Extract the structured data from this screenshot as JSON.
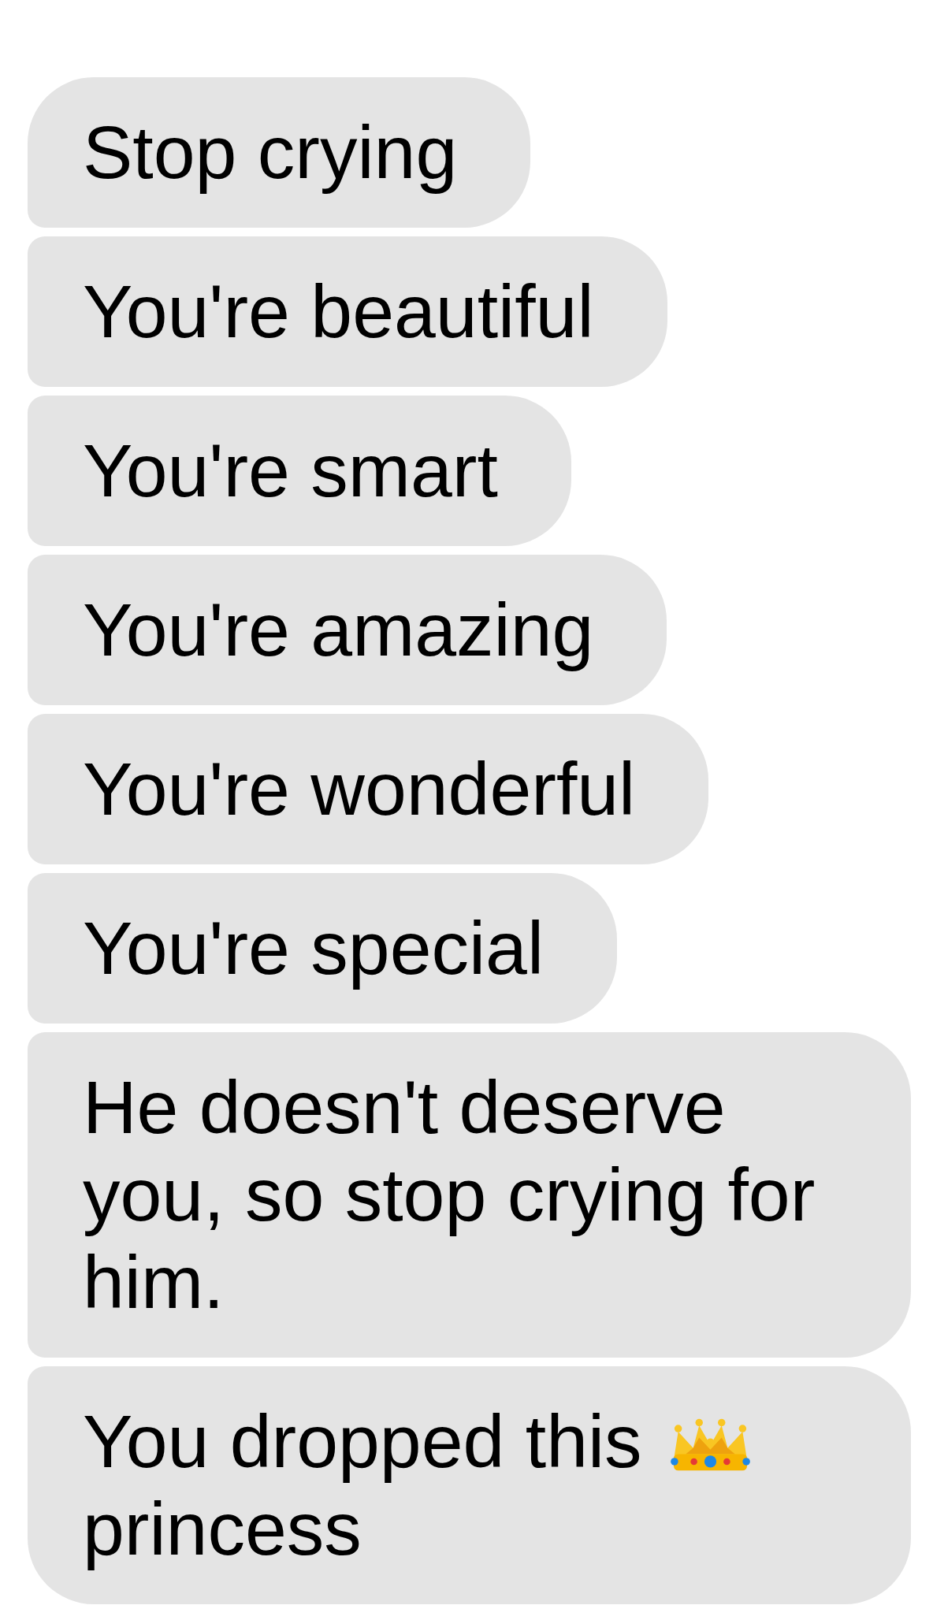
{
  "messages": [
    {
      "kind": "text",
      "text": "Stop crying"
    },
    {
      "kind": "text",
      "text": "You're beautiful"
    },
    {
      "kind": "text",
      "text": "You're smart"
    },
    {
      "kind": "text",
      "text": "You're amazing"
    },
    {
      "kind": "text",
      "text": "You're wonderful"
    },
    {
      "kind": "text",
      "text": "You're special"
    },
    {
      "kind": "text",
      "text": "He doesn't deserve you, so stop crying for him."
    },
    {
      "kind": "emoji",
      "before": "You dropped this",
      "after": "princess"
    }
  ]
}
